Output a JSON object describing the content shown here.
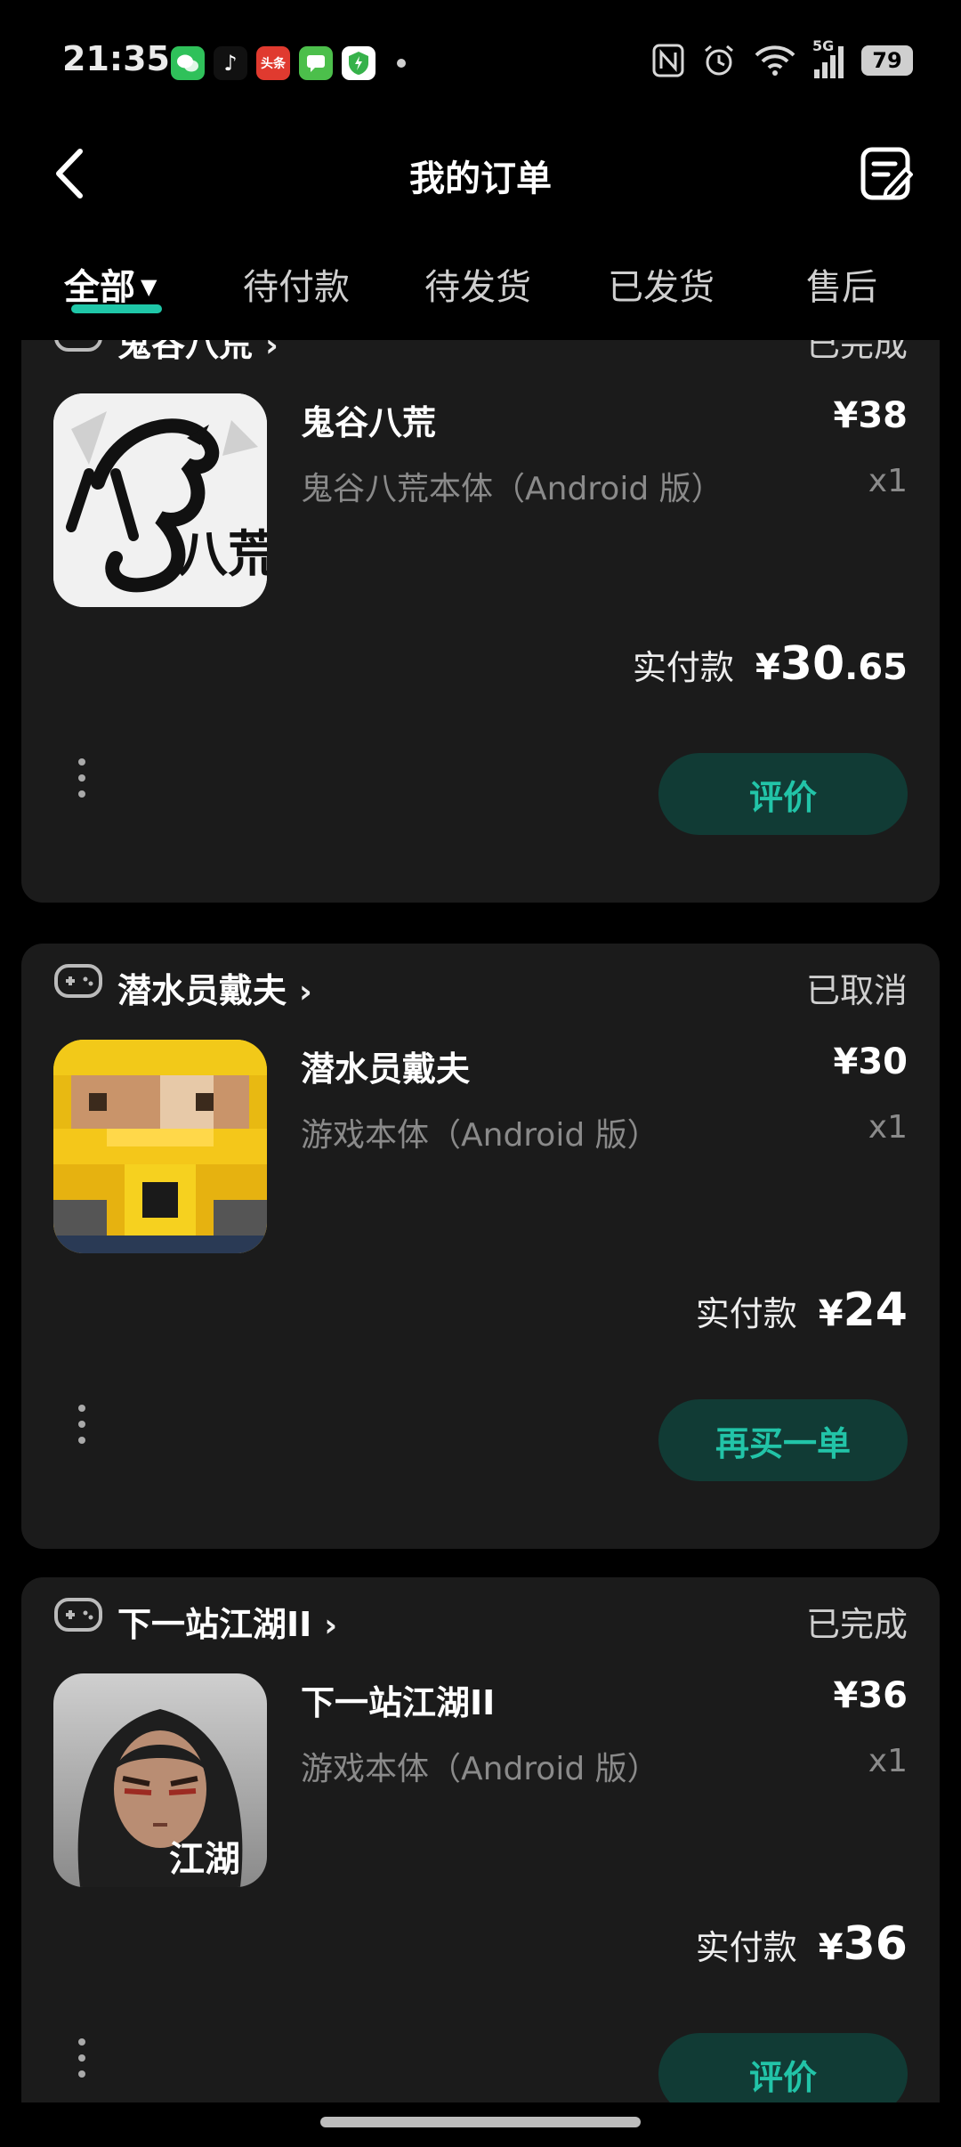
{
  "status_bar": {
    "time": "21:35",
    "notification_icons": [
      {
        "icon": "wechat-icon",
        "color": "#2fc15a",
        "text": ""
      },
      {
        "icon": "tiktok-icon",
        "color": "#000000",
        "text": "♪"
      },
      {
        "icon": "toutiao-icon",
        "color": "#e03a2f",
        "text": "头条"
      },
      {
        "icon": "messages-icon",
        "color": "#4cbf4b",
        "text": ""
      },
      {
        "icon": "security-icon",
        "color": "#36b24a",
        "text": ""
      }
    ],
    "network": "5G",
    "battery": "79"
  },
  "header": {
    "title": "我的订单"
  },
  "tabs": [
    {
      "label": "全部",
      "active": true
    },
    {
      "label": "待付款"
    },
    {
      "label": "待发货"
    },
    {
      "label": "已发货"
    },
    {
      "label": "售后"
    }
  ],
  "orders": [
    {
      "game": "鬼谷八荒",
      "status": "已完成",
      "product_title": "鬼谷八荒",
      "price": "¥38",
      "subtitle": "鬼谷八荒本体（Android 版）",
      "qty": "x1",
      "paid_label": "实付款",
      "paid_currency": "¥",
      "paid_amount": "30",
      "paid_decimal": ".65",
      "action": "评价"
    },
    {
      "game": "潜水员戴夫",
      "status": "已取消",
      "product_title": "潜水员戴夫",
      "price": "¥30",
      "subtitle": "游戏本体（Android 版）",
      "qty": "x1",
      "paid_label": "实付款",
      "paid_currency": "¥",
      "paid_amount": "24",
      "paid_decimal": "",
      "action": "再买一单"
    },
    {
      "game": "下一站江湖II",
      "status": "已完成",
      "product_title": "下一站江湖II",
      "price": "¥36",
      "subtitle": "游戏本体（Android 版）",
      "qty": "x1",
      "paid_label": "实付款",
      "paid_currency": "¥",
      "paid_amount": "36",
      "paid_decimal": "",
      "action": "评价"
    }
  ],
  "thumbnail_labels": [
    "八荒",
    "江湖"
  ],
  "colors": {
    "accent": "#1fc7a8",
    "button_bg": "#113b35",
    "card_bg": "#1b1b1b"
  }
}
